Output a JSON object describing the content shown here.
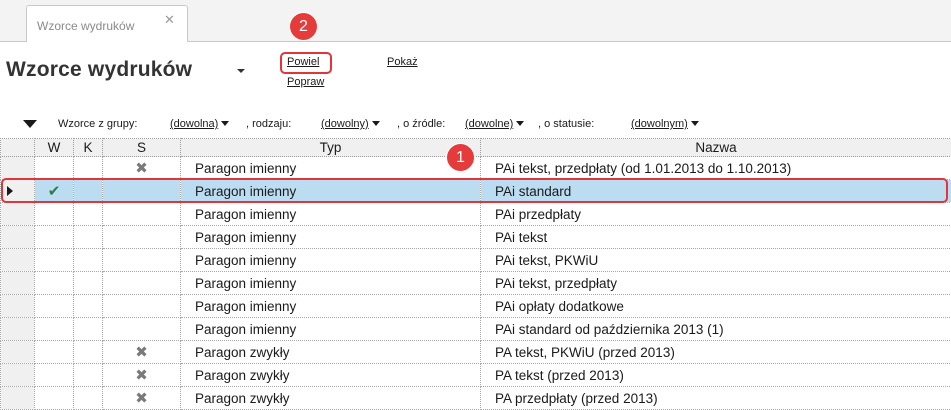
{
  "tab": {
    "label": "Wzorce wydruków",
    "close_glyph": "✕"
  },
  "title": "Wzorce wydruków",
  "actions": {
    "duplicate": "Powiel",
    "edit": "Popraw",
    "show": "Pokaż"
  },
  "callouts": {
    "grid": "1",
    "duplicate": "2"
  },
  "filters": {
    "group_label": "Wzorce z grupy:",
    "group_value": "(dowolna)",
    "type_label": ", rodzaju:",
    "type_value": "(dowolny)",
    "source_label": ", o źródle:",
    "source_value": "(dowolne)",
    "status_label": ", o statusie:",
    "status_value": "(dowolnym)"
  },
  "grid": {
    "columns": {
      "w": "W",
      "k": "K",
      "s": "S",
      "typ": "Typ",
      "nazwa": "Nazwa"
    },
    "rows": [
      {
        "w": "",
        "k": "",
        "s": "✖",
        "typ": "Paragon imienny",
        "nazwa": "PAi tekst, przedpłaty (od 1.01.2013 do 1.10.2013)"
      },
      {
        "w": "✔",
        "k": "",
        "s": "",
        "typ": "Paragon imienny",
        "nazwa": "PAi standard"
      },
      {
        "w": "",
        "k": "",
        "s": "",
        "typ": "Paragon imienny",
        "nazwa": "PAi przedpłaty"
      },
      {
        "w": "",
        "k": "",
        "s": "",
        "typ": "Paragon imienny",
        "nazwa": "PAi tekst"
      },
      {
        "w": "",
        "k": "",
        "s": "",
        "typ": "Paragon imienny",
        "nazwa": "PAi tekst, PKWiU"
      },
      {
        "w": "",
        "k": "",
        "s": "",
        "typ": "Paragon imienny",
        "nazwa": "PAi tekst, przedpłaty"
      },
      {
        "w": "",
        "k": "",
        "s": "",
        "typ": "Paragon imienny",
        "nazwa": "PAi opłaty dodatkowe"
      },
      {
        "w": "",
        "k": "",
        "s": "",
        "typ": "Paragon imienny",
        "nazwa": "PAi standard od października 2013 (1)"
      },
      {
        "w": "",
        "k": "",
        "s": "✖",
        "typ": "Paragon zwykły",
        "nazwa": "PA tekst, PKWiU (przed 2013)"
      },
      {
        "w": "",
        "k": "",
        "s": "✖",
        "typ": "Paragon zwykły",
        "nazwa": "PA tekst (przed 2013)"
      },
      {
        "w": "",
        "k": "",
        "s": "✖",
        "typ": "Paragon zwykły",
        "nazwa": "PA przedpłaty (przed 2013)"
      }
    ]
  },
  "colors": {
    "selected_row": "#bcdcf2",
    "callout": "#e53b3b",
    "check": "#2d7d4a"
  }
}
